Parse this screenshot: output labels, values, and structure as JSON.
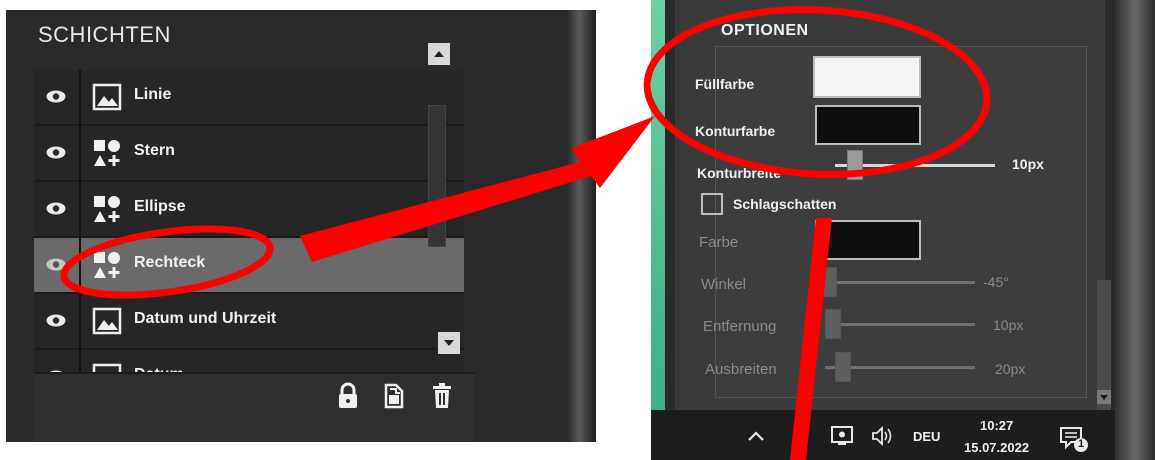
{
  "layers_panel": {
    "title": "SCHICHTEN",
    "items": [
      {
        "label": "Linie",
        "icon": "image-icon",
        "selected": false
      },
      {
        "label": "Stern",
        "icon": "shapes-icon",
        "selected": false
      },
      {
        "label": "Ellipse",
        "icon": "shapes-icon",
        "selected": false
      },
      {
        "label": "Rechteck",
        "icon": "shapes-icon",
        "selected": true
      },
      {
        "label": "Datum und Uhrzeit",
        "icon": "image-icon",
        "selected": false
      },
      {
        "label": "Datum",
        "icon": "image-icon",
        "selected": false
      }
    ],
    "toolbar_icons": [
      "lock-icon",
      "duplicate-icon",
      "trash-icon"
    ]
  },
  "options_panel": {
    "title": "OPTIONEN",
    "fill_label": "Füllfarbe",
    "fill_color": "#f4f4f4",
    "stroke_label": "Konturfarbe",
    "stroke_color": "#0e0e10",
    "stroke_width_label": "Konturbreite",
    "stroke_width_value": "10px",
    "shadow_label": "Schlagschatten",
    "shadow_checked": false,
    "shadow_color_label": "Farbe",
    "shadow_color": "#0e0e10",
    "angle_label": "Winkel",
    "angle_value": "-45°",
    "distance_label": "Entfernung",
    "distance_value": "10px",
    "spread_label": "Ausbreiten",
    "spread_value": "20px"
  },
  "taskbar": {
    "language": "DEU",
    "time": "10:27",
    "date": "15.07.2022",
    "notification_count": "1"
  },
  "colors": {
    "annotation_red": "#ff0000",
    "panel_dark": "#2a2a2a",
    "selected_row": "#6a6a6a"
  }
}
